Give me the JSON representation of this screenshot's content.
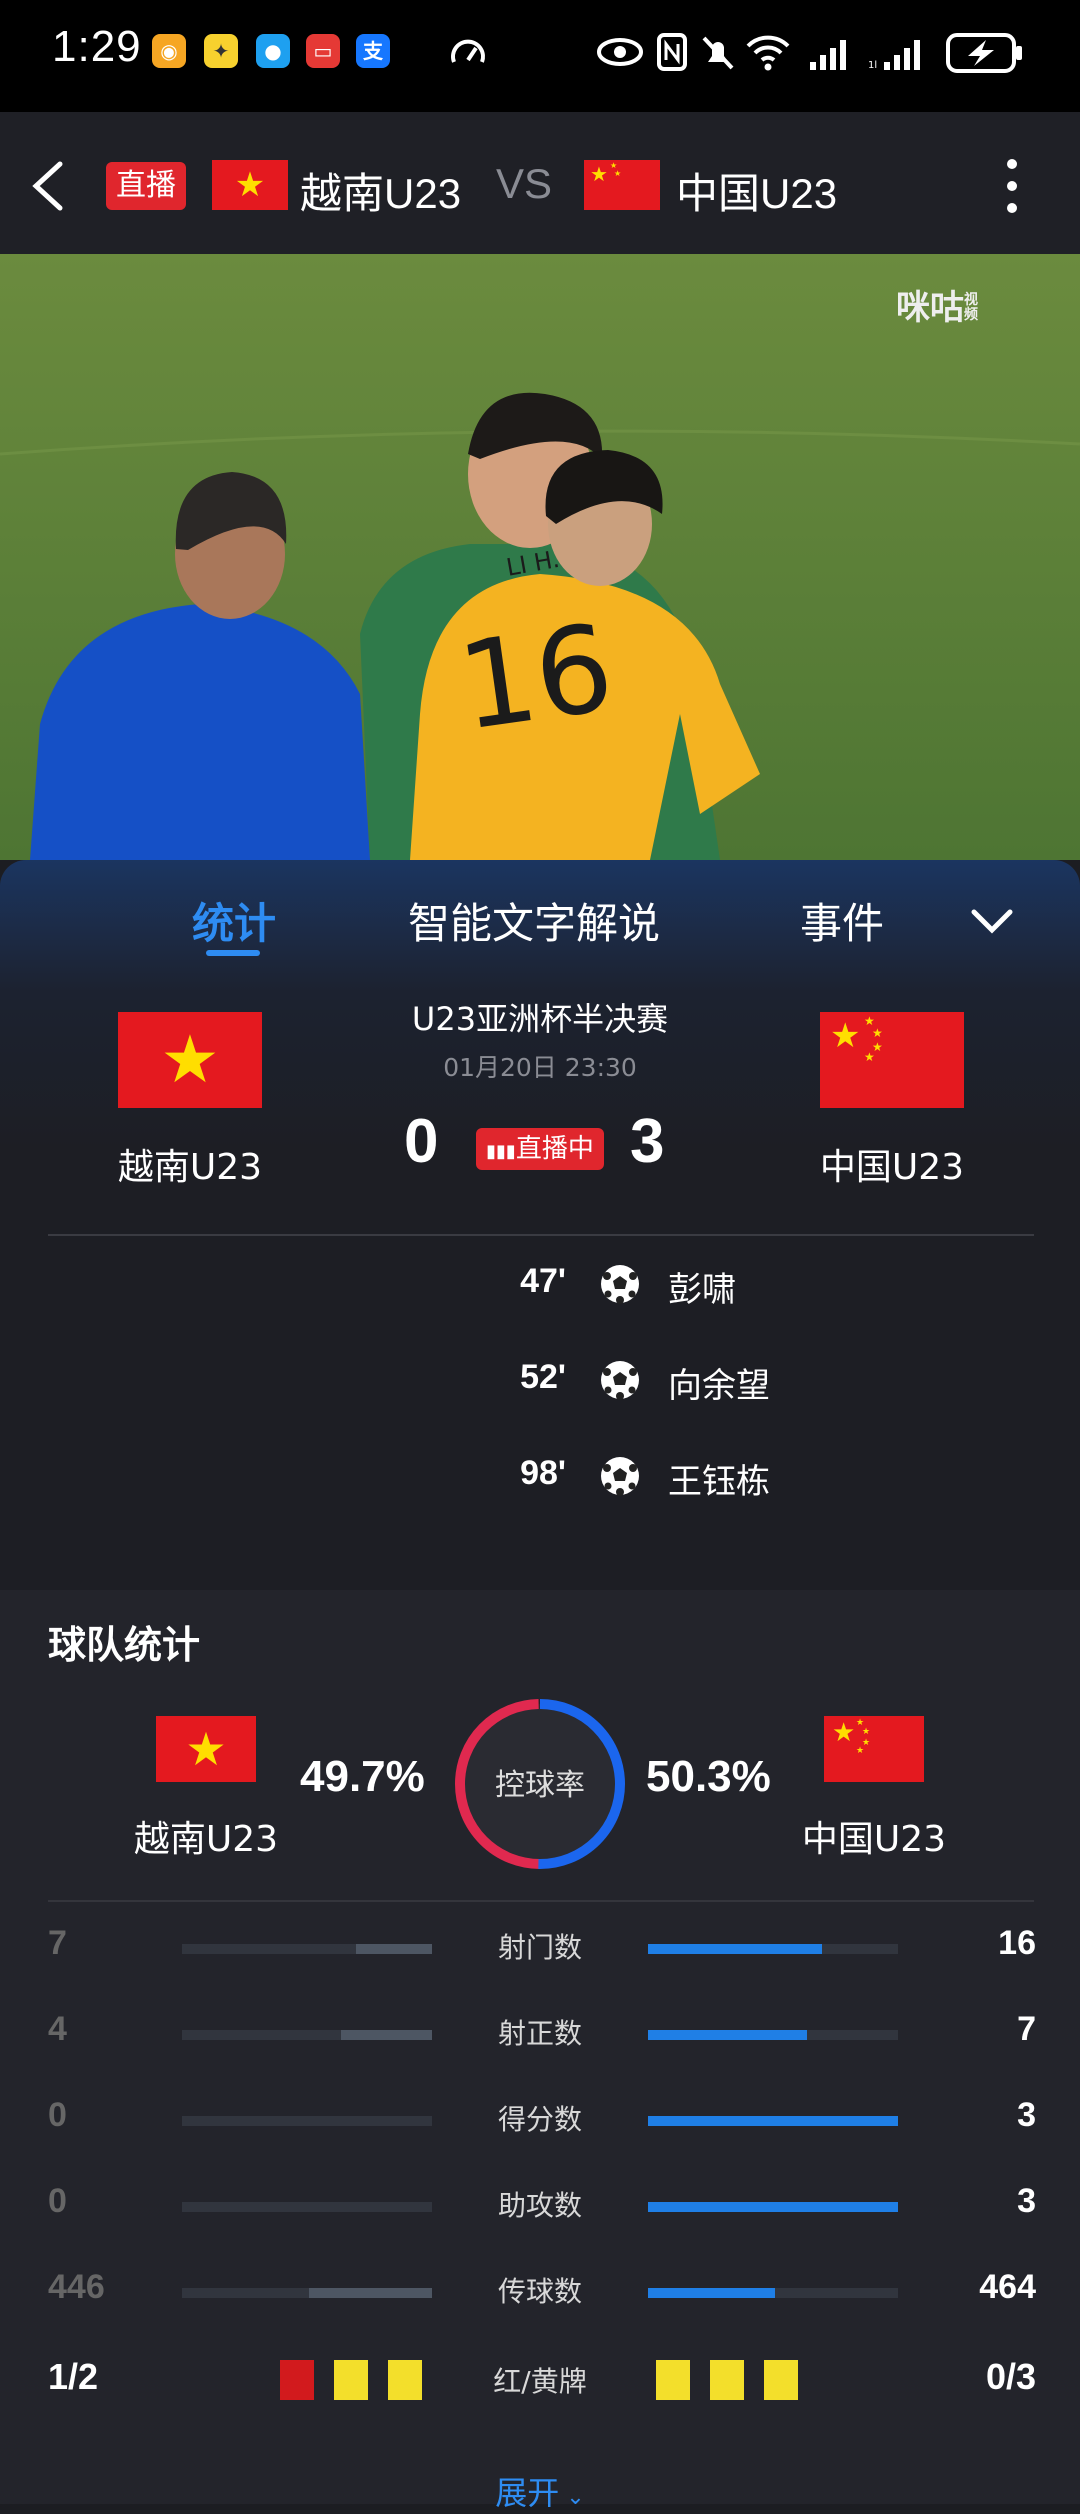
{
  "status_bar": {
    "time": "1:29"
  },
  "header": {
    "live_tag": "直播",
    "home_team": "越南U23",
    "vs": "VS",
    "away_team": "中国U23"
  },
  "video": {
    "watermark": "咪咕",
    "watermark_sub": "视频",
    "player_name": "LI H.",
    "player_number": "16"
  },
  "tabs": [
    {
      "label": "统计",
      "active": true
    },
    {
      "label": "智能文字解说",
      "active": false
    },
    {
      "label": "事件",
      "active": false
    }
  ],
  "match": {
    "competition": "U23亚洲杯半决赛",
    "datetime": "01月20日 23:30",
    "home_team": "越南U23",
    "away_team": "中国U23",
    "home_score": "0",
    "away_score": "3",
    "status": "直播中"
  },
  "goals": [
    {
      "minute": "47'",
      "player": "彭啸"
    },
    {
      "minute": "52'",
      "player": "向余望"
    },
    {
      "minute": "98'",
      "player": "王钰栋"
    }
  ],
  "team_stats": {
    "title": "球队统计",
    "home_team": "越南U23",
    "away_team": "中国U23",
    "possession_label": "控球率",
    "home_possession": "49.7%",
    "away_possession": "50.3%",
    "home_possession_value": 49.7,
    "away_possession_value": 50.3,
    "rows": [
      {
        "label": "射门数",
        "home": "7",
        "away": "16",
        "home_v": 7,
        "away_v": 16
      },
      {
        "label": "射正数",
        "home": "4",
        "away": "7",
        "home_v": 4,
        "away_v": 7
      },
      {
        "label": "得分数",
        "home": "0",
        "away": "3",
        "home_v": 0,
        "away_v": 3
      },
      {
        "label": "助攻数",
        "home": "0",
        "away": "3",
        "home_v": 0,
        "away_v": 3
      },
      {
        "label": "传球数",
        "home": "446",
        "away": "464",
        "home_v": 446,
        "away_v": 464
      }
    ],
    "cards": {
      "label": "红/黄牌",
      "home": "1/2",
      "away": "0/3",
      "home_red": 1,
      "home_yellow": 2,
      "away_red": 0,
      "away_yellow": 3
    },
    "expand_label": "展开"
  },
  "colors": {
    "accent": "#1f7fe6",
    "live_red": "#e0262d",
    "home_ring": "#e0294f",
    "away_ring": "#1b66ee",
    "yellow_card": "#f3df2b",
    "red_card": "#d21a1d"
  }
}
